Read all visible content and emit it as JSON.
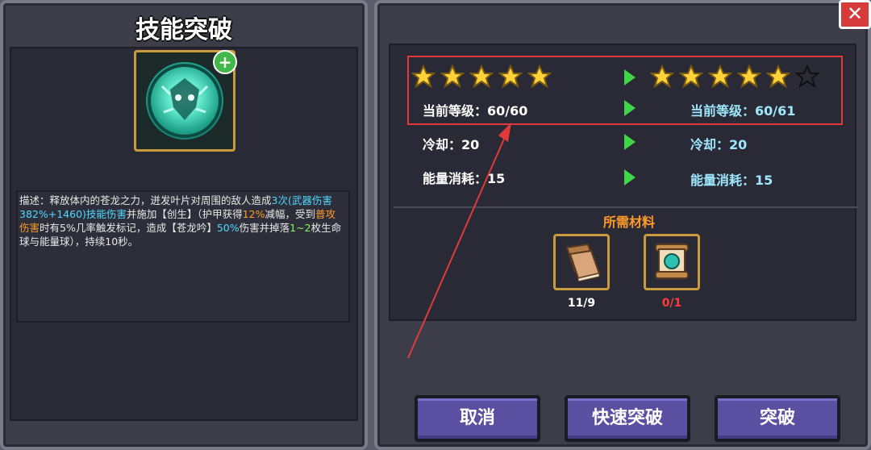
{
  "left": {
    "title": "技能突破",
    "skill_name": "苍龙吟",
    "badge": "+",
    "desc": {
      "p1": "描述：释放体内的苍龙之力，迸发叶片对周围的敌人造成",
      "p2": "3次",
      "p3": "(武器伤害382%+1460)技能伤害",
      "p4": "并施加【创生】（护甲获得",
      "p5": "12%",
      "p6": "减幅，受到",
      "p7": "普攻伤害",
      "p8": "时有5%几率触发标记，造成【苍龙吟】",
      "p9": "50%",
      "p10": "伤害并掉落",
      "p11": "1~2",
      "p12": "枚生命球与能量球），持续10秒。"
    }
  },
  "right": {
    "current_stars": 5,
    "next_stars_filled": 5,
    "next_stars_total": 6,
    "level_label_left": "当前等级：60/60",
    "level_label_right": "当前等级：60/61",
    "cooldown_left": "冷却：20",
    "cooldown_right": "冷却：20",
    "energy_left": "能量消耗：15",
    "energy_right": "能量消耗：15",
    "materials_title": "所需材料",
    "materials": [
      {
        "icon": "book-icon",
        "count": "11/9",
        "color": "#ffffff"
      },
      {
        "icon": "scroll-icon",
        "count": "0/1",
        "color": "#ff3b3b"
      }
    ]
  },
  "buttons": {
    "cancel": "取消",
    "quick": "快速突破",
    "breakthrough": "突破",
    "close": "✕"
  },
  "colors": {
    "star": "#ffd23a",
    "arrow": "#3fd64a",
    "highlight_box": "#e03a3a",
    "button": "#5a4fa0"
  }
}
